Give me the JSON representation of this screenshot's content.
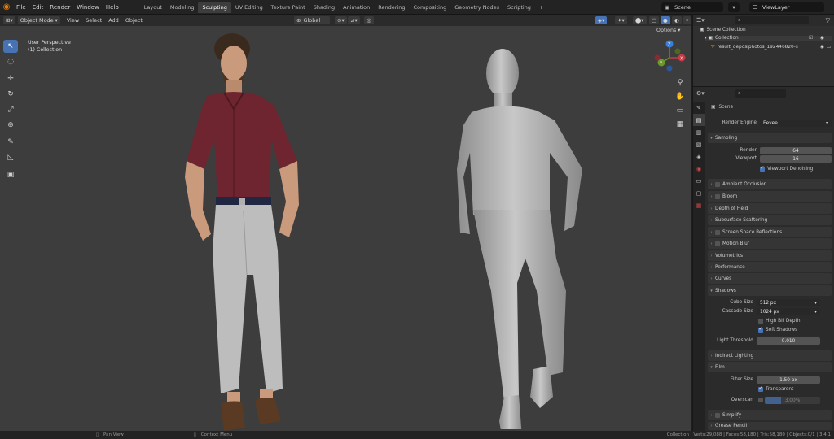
{
  "menu": {
    "items": [
      "File",
      "Edit",
      "Render",
      "Window",
      "Help"
    ]
  },
  "workspaces": {
    "tabs": [
      {
        "label": "Layout",
        "active": false
      },
      {
        "label": "Modeling",
        "active": false
      },
      {
        "label": "Sculpting",
        "active": true
      },
      {
        "label": "UV Editing",
        "active": false
      },
      {
        "label": "Texture Paint",
        "active": false
      },
      {
        "label": "Shading",
        "active": false
      },
      {
        "label": "Animation",
        "active": false
      },
      {
        "label": "Rendering",
        "active": false
      },
      {
        "label": "Compositing",
        "active": false
      },
      {
        "label": "Geometry Nodes",
        "active": false
      },
      {
        "label": "Scripting",
        "active": false
      }
    ],
    "add_label": "+"
  },
  "scene": {
    "name": "Scene",
    "view_layer": "ViewLayer"
  },
  "viewport_header": {
    "mode": "Object Mode",
    "view": "View",
    "select": "Select",
    "add": "Add",
    "object": "Object",
    "transform": "Global",
    "options": "Options"
  },
  "viewport": {
    "perspective": "User Perspective",
    "collection": "(1) Collection",
    "gizmo_x": "X",
    "gizmo_y": "Y",
    "gizmo_z": "Z"
  },
  "outliner": {
    "root": "Scene Collection",
    "collection": "Collection",
    "object": "result_deposiphotos_192446820-s"
  },
  "properties": {
    "context": "Scene",
    "render_engine_label": "Render Engine",
    "render_engine": "Eevee",
    "sampling": {
      "title": "Sampling",
      "render_label": "Render",
      "render": "64",
      "viewport_label": "Viewport",
      "viewport": "16",
      "denoise": "Viewport Denoising"
    },
    "panels": [
      "Ambient Occlusion",
      "Bloom",
      "Depth of Field",
      "Subsurface Scattering",
      "Screen Space Reflections",
      "Motion Blur",
      "Volumetrics",
      "Performance",
      "Curves"
    ],
    "shadows": {
      "title": "Shadows",
      "cube_label": "Cube Size",
      "cube": "512 px",
      "cascade_label": "Cascade Size",
      "cascade": "1024 px",
      "high_bit": "High Bit Depth",
      "soft": "Soft Shadows",
      "light_label": "Light Threshold",
      "light": "0.010"
    },
    "indirect": "Indirect Lighting",
    "film": {
      "title": "Film",
      "filter_label": "Filter Size",
      "filter": "1.50 px",
      "transparent": "Transparent",
      "overscan_label": "Overscan",
      "overscan": "3.00%"
    },
    "simplify": "Simplify",
    "grease": "Grease Pencil"
  },
  "status": {
    "pan": "Pan View",
    "context": "Context Menu",
    "stats": "Collection | Verts:29,088 | Faces:58,180 | Tris:58,180 | Objects:0/1 | 3.4.1"
  },
  "colors": {
    "accent": "#4772b3",
    "active_orange": "#e87d0d",
    "viewport_bg": "#3d3d3d",
    "shirt": "#6e2530",
    "mesh": "#b8b8b8"
  }
}
